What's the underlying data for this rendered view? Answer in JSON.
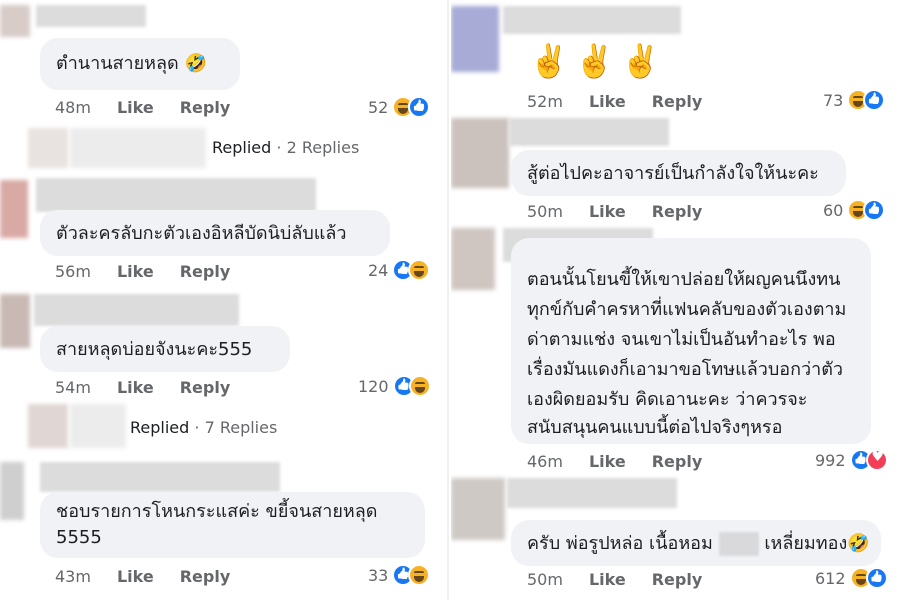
{
  "left": {
    "comments": [
      {
        "text": "ตำนานสายหลุด 🤣",
        "time": "48m",
        "like": "Like",
        "reply": "Reply",
        "reaction_count": "52"
      },
      {
        "text": "ตัวละครลับกะตัวเองอิหลีบัดนิบ่ลับแล้ว",
        "time": "56m",
        "like": "Like",
        "reply": "Reply",
        "reaction_count": "24"
      },
      {
        "text": "สายหลุดบ่อยจังนะคะ555",
        "time": "54m",
        "like": "Like",
        "reply": "Reply",
        "reaction_count": "120"
      },
      {
        "text_line1": "ชอบรายการโหนกระแสค่ะ  ขยี้จนสายหลุด",
        "text_line2": "5555",
        "time": "43m",
        "like": "Like",
        "reply": "Reply",
        "reaction_count": "33"
      }
    ],
    "replies": [
      {
        "label": "Replied",
        "sep": " · ",
        "count": "2 Replies"
      },
      {
        "label": "Replied",
        "sep": " · ",
        "count": "7 Replies"
      }
    ]
  },
  "right": {
    "comments": [
      {
        "text": "✌️✌️✌️",
        "time": "52m",
        "like": "Like",
        "reply": "Reply",
        "reaction_count": "73"
      },
      {
        "text": "สู้ต่อไปคะอาจารย์เป็นกำลังใจให้นะคะ",
        "time": "50m",
        "like": "Like",
        "reply": "Reply",
        "reaction_count": "60"
      },
      {
        "lines": [
          "ตอนนั้นโยนขี้ให้เขาปล่อยให้ผญคนนึงทน",
          "ทุกข์กับคำครหาที่แฟนคลับของตัวเองตาม",
          "ด่าตามแช่ง จนเขาไม่เป็นอันทำอะไร พอ",
          "เรื่องมันแดงก็เอามาขอโทษแล้วบอกว่าตัว",
          "เองผิดยอมรับ คิดเอานะคะ ว่าควรจะ",
          "สนับสนุนคนแบบนี้ต่อไปจริงๆหรอ"
        ],
        "time": "46m",
        "like": "Like",
        "reply": "Reply",
        "reaction_count": "992"
      },
      {
        "text_pre": "ครับ พ่อรูปหล่อ เนื้อหอม ",
        "text_post": " เหลี่ยมทอง🤣",
        "time": "50m",
        "like": "Like",
        "reply": "Reply",
        "reaction_count": "612"
      }
    ]
  }
}
